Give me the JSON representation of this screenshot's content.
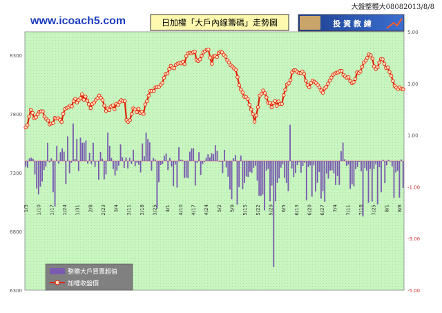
{
  "header": {
    "site": "www.icoach5.com",
    "top_right": "大盤整體大08082013/8/8",
    "title": "日加權「大戶內線籌碼」走勢圖",
    "logo_text": "投 資 教 練"
  },
  "colors": {
    "plot_bg": "#c8f5c0",
    "bar": "#7a5bb0",
    "line": "#e02000",
    "marker_fill": "#ffe0c0",
    "legend_bg": "#808080"
  },
  "chart_data": {
    "type": "bar+line",
    "left_axis": {
      "ticks": [
        6300,
        6800,
        7300,
        7800,
        8300
      ],
      "ylim": [
        6300,
        8500
      ]
    },
    "right_axis": {
      "ticks": [
        -5.0,
        -3.0,
        -1.0,
        1.0,
        3.0,
        5.0
      ],
      "tick_labels": [
        "-5.00",
        "-3.00",
        "-1.00",
        "1.00",
        "3.00",
        "5.00"
      ],
      "ylim": [
        -5.0,
        5.0
      ]
    },
    "x_tick_labels": [
      "1/3",
      "1/10",
      "1/17",
      "1/24",
      "1/31",
      "2/8",
      "2/23",
      "3/4",
      "3/11",
      "3/18",
      "3/25",
      "4/1",
      "4/10",
      "4/17",
      "4/24",
      "5/2",
      "5/9",
      "5/15",
      "5/22",
      "5/29",
      "6/5",
      "6/13",
      "6/20",
      "6/27",
      "7/4",
      "7/11",
      "7/18",
      "7/25",
      "8/1",
      "8/8"
    ],
    "series": [
      {
        "name": "整體大戶買賣超值",
        "kind": "bar",
        "axis": "right",
        "values": [
          -0.22,
          -0.26,
          0.1,
          0.13,
          0.09,
          -0.52,
          -1.06,
          -1.29,
          -0.99,
          -0.79,
          -0.35,
          -0.22,
          0.7,
          -0.05,
          0.1,
          -1.21,
          -1.76,
          0.59,
          -0.1,
          0.34,
          0.49,
          0.36,
          -0.89,
          0.95,
          -0.48,
          -0.07,
          1.45,
          0.08,
          0.85,
          -0.39,
          0.9,
          0.7,
          0.71,
          0.79,
          -0.1,
          0.32,
          -0.12,
          0.7,
          -0.23,
          -0.01,
          -0.72,
          0.35,
          0.09,
          -0.71,
          -0.52,
          1.1,
          0.59,
          0.12,
          -0.31,
          -0.56,
          -0.37,
          -0.18,
          0.64,
          0.15,
          -0.27,
          0.14,
          -0.29,
          0.12,
          -0.11,
          0.43,
          -0.2,
          -0.07,
          -0.15,
          -0.44,
          0.68,
          0.18,
          1.1,
          0.85,
          0.72,
          -0.37,
          0.12,
          0.06,
          -1.84,
          -0.82,
          -0.16,
          -0.11,
          0.2,
          0.29,
          -0.35,
          0.12,
          -0.21,
          -0.97,
          -0.14,
          -1.03,
          0.53,
          0.05,
          0.04,
          -0.66,
          -0.64,
          -0.66,
          0.36,
          0.49,
          0.49,
          -0.95,
          -0.07,
          0.34,
          -0.54,
          -0.12,
          -0.05,
          0.13,
          0.26,
          0.14,
          0.3,
          0.27,
          0.61,
          0.39,
          -0.02,
          -0.03,
          -0.47,
          0.43,
          -0.25,
          -0.61,
          -1.1,
          -1.48,
          0.11,
          0.23,
          -1.69,
          -1.01,
          0.21,
          -1.09,
          -0.85,
          -0.6,
          -0.62,
          -0.42,
          -0.46,
          -0.26,
          -0.18,
          -0.76,
          -1.35,
          -1.36,
          -1.3,
          -1.91,
          -0.37,
          -0.31,
          -1.56,
          -0.95,
          -4.1,
          -1.56,
          -0.85,
          -0.67,
          -0.26,
          -0.13,
          -0.65,
          -0.85,
          -1.16,
          1.4,
          -0.29,
          -0.62,
          -0.46,
          -0.16,
          -0.04,
          -0.45,
          -0.19,
          -0.07,
          -1.52,
          -0.24,
          -0.17,
          -1.38,
          -0.17,
          -1.18,
          -0.85,
          -0.43,
          -1.46,
          -1.17,
          -1.58,
          -0.49,
          -0.68,
          -0.37,
          -0.36,
          -0.48,
          -0.93,
          -0.58,
          -0.93,
          0.38,
          0.71,
          0.07,
          -0.19,
          -0.13,
          -1.08,
          -0.9,
          -0.97,
          -0.32,
          -0.23,
          -0.03,
          -0.4,
          -2.15,
          -0.28,
          -0.37,
          -1.62,
          -0.31,
          -1.57,
          -0.31,
          -0.13,
          -1.68,
          -0.24,
          -1.21,
          0.05,
          -0.86,
          -0.17,
          0.04,
          -0.02,
          -0.21,
          -1.43,
          -0.44,
          -0.38,
          -1.42,
          0.06,
          -1.04
        ]
      },
      {
        "name": "加權收盤價",
        "kind": "line",
        "axis": "left",
        "values": [
          7686,
          7706,
          7779,
          7836,
          7809,
          7763,
          7772,
          7797,
          7819,
          7823,
          7822,
          7778,
          7759,
          7745,
          7712,
          7719,
          7723,
          7766,
          7761,
          7764,
          7751,
          7733,
          7802,
          7843,
          7852,
          7858,
          7871,
          7865,
          7910,
          7930,
          7897,
          7919,
          7935,
          7968,
          7922,
          7948,
          7913,
          7883,
          7850,
          7885,
          7897,
          7918,
          7934,
          7957,
          7938,
          7918,
          7872,
          7826,
          7847,
          7834,
          7865,
          7873,
          7841,
          7886,
          7877,
          7902,
          7918,
          7911,
          7910,
          7750,
          7733,
          7747,
          7800,
          7847,
          7839,
          7816,
          7845,
          7810,
          7820,
          7801,
          7882,
          7908,
          7957,
          7996,
          7998,
          7996,
          8027,
          8029,
          8030,
          8048,
          8064,
          8108,
          8141,
          8145,
          8183,
          8210,
          8195,
          8190,
          8219,
          8229,
          8237,
          8231,
          8245,
          8225,
          8292,
          8316,
          8321,
          8317,
          8325,
          8330,
          8260,
          8251,
          8265,
          8295,
          8325,
          8335,
          8347,
          8349,
          8280,
          8228,
          8293,
          8294,
          8285,
          8321,
          8330,
          8324,
          8304,
          8288,
          8258,
          8239,
          8215,
          8204,
          8188,
          8176,
          8114,
          8045,
          8008,
          7983,
          7947,
          7944,
          7928,
          7879,
          7840,
          7798,
          7735,
          7789,
          7859,
          7956,
          7973,
          8000,
          7977,
          7941,
          7895,
          7895,
          7857,
          7894,
          7910,
          7870,
          7907,
          7885,
          7886,
          7960,
          8006,
          8052,
          8061,
          8089,
          8154,
          8172,
          8172,
          8158,
          8148,
          8150,
          8162,
          8141,
          8083,
          8047,
          8028,
          8063,
          8085,
          8075,
          8063,
          8047,
          8027,
          8000,
          7981,
          8018,
          8031,
          8058,
          8084,
          8110,
          8135,
          8145,
          8152,
          8155,
          8166,
          8167,
          8133,
          8120,
          8107,
          8114,
          8082,
          8063,
          8071,
          8099,
          8154,
          8150,
          8163,
          8203,
          8238,
          8254,
          8278,
          8307,
          8300,
          8272,
          8206,
          8183,
          8199,
          8238,
          8268,
          8265,
          8227,
          8191,
          8196,
          8158,
          8126,
          8082,
          8040,
          8025,
          8011,
          8027,
          8015,
          8010
        ]
      }
    ]
  }
}
